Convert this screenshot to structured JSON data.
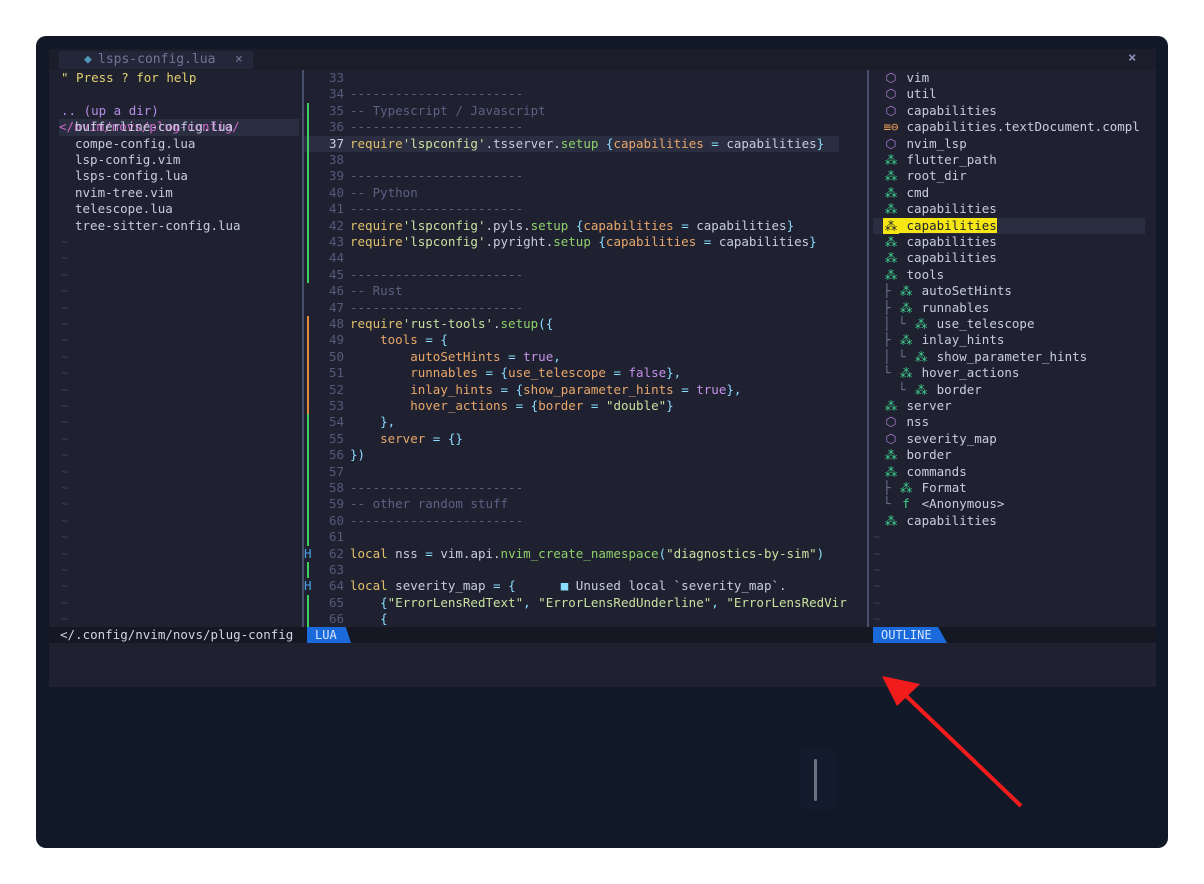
{
  "tab": {
    "icon": "lua-file-icon",
    "label": "lsps-config.lua",
    "close": "×"
  },
  "close_all": "×",
  "tree": {
    "help": "\" Press ? for help",
    "up": ".. (up a dir)",
    "cwd": "</nvim/novs/plug-config/",
    "files": [
      "bufferline-config.lua",
      "compe-config.lua",
      "lsp-config.vim",
      "lsps-config.lua",
      "nvim-tree.vim",
      "telescope.lua",
      "tree-sitter-config.lua"
    ],
    "tilde": "~"
  },
  "editor": {
    "lines": [
      {
        "n": "33",
        "segs": []
      },
      {
        "n": "34",
        "segs": [
          [
            "c-com",
            "-----------------------"
          ]
        ]
      },
      {
        "n": "35",
        "segs": [
          [
            "c-com",
            "-- Typescript / Javascript"
          ]
        ]
      },
      {
        "n": "36",
        "segs": [
          [
            "c-com",
            "-----------------------"
          ]
        ]
      },
      {
        "n": "37",
        "cur": true,
        "segs": [
          [
            "c-kw",
            "require"
          ],
          [
            "c-str",
            "'lspconfig'"
          ],
          [
            "c-var",
            ".tsserver."
          ],
          [
            "c-fn",
            "setup"
          ],
          [
            "c-var",
            " "
          ],
          [
            "c-punc",
            "{"
          ],
          [
            "c-prop",
            "capabilities"
          ],
          [
            "c-var",
            " "
          ],
          [
            "c-punc",
            "="
          ],
          [
            "c-var",
            " capabilities"
          ],
          [
            "c-punc",
            "}"
          ]
        ]
      },
      {
        "n": "38",
        "segs": []
      },
      {
        "n": "39",
        "segs": [
          [
            "c-com",
            "-----------------------"
          ]
        ]
      },
      {
        "n": "40",
        "segs": [
          [
            "c-com",
            "-- Python"
          ]
        ]
      },
      {
        "n": "41",
        "segs": [
          [
            "c-com",
            "-----------------------"
          ]
        ]
      },
      {
        "n": "42",
        "segs": [
          [
            "c-kw",
            "require"
          ],
          [
            "c-str",
            "'lspconfig'"
          ],
          [
            "c-var",
            ".pyls."
          ],
          [
            "c-fn",
            "setup"
          ],
          [
            "c-var",
            " "
          ],
          [
            "c-punc",
            "{"
          ],
          [
            "c-prop",
            "capabilities"
          ],
          [
            "c-var",
            " "
          ],
          [
            "c-punc",
            "="
          ],
          [
            "c-var",
            " capabilities"
          ],
          [
            "c-punc",
            "}"
          ]
        ]
      },
      {
        "n": "43",
        "segs": [
          [
            "c-kw",
            "require"
          ],
          [
            "c-str",
            "'lspconfig'"
          ],
          [
            "c-var",
            ".pyright."
          ],
          [
            "c-fn",
            "setup"
          ],
          [
            "c-var",
            " "
          ],
          [
            "c-punc",
            "{"
          ],
          [
            "c-prop",
            "capabilities"
          ],
          [
            "c-var",
            " "
          ],
          [
            "c-punc",
            "="
          ],
          [
            "c-var",
            " capabilities"
          ],
          [
            "c-punc",
            "}"
          ]
        ]
      },
      {
        "n": "44",
        "segs": []
      },
      {
        "n": "45",
        "segs": [
          [
            "c-com",
            "-----------------------"
          ]
        ]
      },
      {
        "n": "46",
        "segs": [
          [
            "c-com",
            "-- Rust"
          ]
        ]
      },
      {
        "n": "47",
        "segs": [
          [
            "c-com",
            "-----------------------"
          ]
        ]
      },
      {
        "n": "48",
        "segs": [
          [
            "c-kw",
            "require"
          ],
          [
            "c-str",
            "'rust-tools'"
          ],
          [
            "c-var",
            "."
          ],
          [
            "c-fn",
            "setup"
          ],
          [
            "c-punc",
            "({"
          ]
        ]
      },
      {
        "n": "49",
        "segs": [
          [
            "c-var",
            "    "
          ],
          [
            "c-prop",
            "tools"
          ],
          [
            "c-var",
            " "
          ],
          [
            "c-punc",
            "="
          ],
          [
            "c-var",
            " "
          ],
          [
            "c-punc",
            "{"
          ]
        ]
      },
      {
        "n": "50",
        "segs": [
          [
            "c-var",
            "        "
          ],
          [
            "c-prop",
            "autoSetHints"
          ],
          [
            "c-var",
            " "
          ],
          [
            "c-punc",
            "="
          ],
          [
            "c-var",
            " "
          ],
          [
            "c-bool",
            "true"
          ],
          [
            "c-punc",
            ","
          ]
        ]
      },
      {
        "n": "51",
        "segs": [
          [
            "c-var",
            "        "
          ],
          [
            "c-prop",
            "runnables"
          ],
          [
            "c-var",
            " "
          ],
          [
            "c-punc",
            "="
          ],
          [
            "c-var",
            " "
          ],
          [
            "c-punc",
            "{"
          ],
          [
            "c-prop",
            "use_telescope"
          ],
          [
            "c-var",
            " "
          ],
          [
            "c-punc",
            "="
          ],
          [
            "c-var",
            " "
          ],
          [
            "c-bool",
            "false"
          ],
          [
            "c-punc",
            "},"
          ]
        ]
      },
      {
        "n": "52",
        "segs": [
          [
            "c-var",
            "        "
          ],
          [
            "c-prop",
            "inlay_hints"
          ],
          [
            "c-var",
            " "
          ],
          [
            "c-punc",
            "="
          ],
          [
            "c-var",
            " "
          ],
          [
            "c-punc",
            "{"
          ],
          [
            "c-prop",
            "show_parameter_hints"
          ],
          [
            "c-var",
            " "
          ],
          [
            "c-punc",
            "="
          ],
          [
            "c-var",
            " "
          ],
          [
            "c-bool",
            "true"
          ],
          [
            "c-punc",
            "},"
          ]
        ]
      },
      {
        "n": "53",
        "segs": [
          [
            "c-var",
            "        "
          ],
          [
            "c-prop",
            "hover_actions"
          ],
          [
            "c-var",
            " "
          ],
          [
            "c-punc",
            "="
          ],
          [
            "c-var",
            " "
          ],
          [
            "c-punc",
            "{"
          ],
          [
            "c-prop",
            "border"
          ],
          [
            "c-var",
            " "
          ],
          [
            "c-punc",
            "="
          ],
          [
            "c-var",
            " "
          ],
          [
            "c-str",
            "\"double\""
          ],
          [
            "c-punc",
            "}"
          ]
        ]
      },
      {
        "n": "54",
        "segs": [
          [
            "c-var",
            "    "
          ],
          [
            "c-punc",
            "},"
          ]
        ]
      },
      {
        "n": "55",
        "segs": [
          [
            "c-var",
            "    "
          ],
          [
            "c-prop",
            "server"
          ],
          [
            "c-var",
            " "
          ],
          [
            "c-punc",
            "="
          ],
          [
            "c-var",
            " "
          ],
          [
            "c-punc",
            "{}"
          ]
        ]
      },
      {
        "n": "56",
        "segs": [
          [
            "c-punc",
            "})"
          ]
        ]
      },
      {
        "n": "57",
        "segs": []
      },
      {
        "n": "58",
        "segs": [
          [
            "c-com",
            "-----------------------"
          ]
        ]
      },
      {
        "n": "59",
        "segs": [
          [
            "c-com",
            "-- other random stuff"
          ]
        ]
      },
      {
        "n": "60",
        "segs": [
          [
            "c-com",
            "-----------------------"
          ]
        ]
      },
      {
        "n": "61",
        "segs": []
      },
      {
        "n": "62",
        "hint": "H",
        "segs": [
          [
            "c-kw",
            "local"
          ],
          [
            "c-var",
            " nss "
          ],
          [
            "c-punc",
            "="
          ],
          [
            "c-var",
            " vim.api."
          ],
          [
            "c-fn",
            "nvim_create_namespace"
          ],
          [
            "c-punc",
            "("
          ],
          [
            "c-str",
            "\"diagnostics-by-sim\""
          ],
          [
            "c-punc",
            ")"
          ]
        ]
      },
      {
        "n": "63",
        "segs": []
      },
      {
        "n": "64",
        "hint": "H",
        "segs": [
          [
            "c-kw",
            "local"
          ],
          [
            "c-var",
            " severity_map "
          ],
          [
            "c-punc",
            "="
          ],
          [
            "c-var",
            " "
          ],
          [
            "c-punc",
            "{"
          ],
          [
            "c-var",
            "      "
          ],
          [
            "c-punc",
            "■"
          ],
          [
            "c-var",
            " Unused local `severity_map`."
          ]
        ]
      },
      {
        "n": "65",
        "segs": [
          [
            "c-var",
            "    "
          ],
          [
            "c-punc",
            "{"
          ],
          [
            "c-str",
            "\"ErrorLensRedText\""
          ],
          [
            "c-punc",
            ","
          ],
          [
            "c-var",
            " "
          ],
          [
            "c-str",
            "\"ErrorLensRedUnderline\""
          ],
          [
            "c-punc",
            ","
          ],
          [
            "c-var",
            " "
          ],
          [
            "c-str",
            "\"ErrorLensRedVir"
          ]
        ]
      },
      {
        "n": "66",
        "segs": [
          [
            "c-var",
            "    "
          ],
          [
            "c-punc",
            "{"
          ]
        ]
      }
    ]
  },
  "outline": {
    "items": [
      {
        "icon": "⬡",
        "cls": "o-mod",
        "guide": "",
        "label": "vim"
      },
      {
        "icon": "⬡",
        "cls": "o-mod",
        "guide": "",
        "label": "util"
      },
      {
        "icon": "⬡",
        "cls": "o-mod",
        "guide": "",
        "label": "capabilities"
      },
      {
        "icon": "≡⊖",
        "cls": "o-orange",
        "guide": "",
        "label": "capabilities.textDocument.compl"
      },
      {
        "icon": "⬡",
        "cls": "o-mod",
        "guide": "",
        "label": "nvim_lsp"
      },
      {
        "icon": "⁂",
        "cls": "o-var",
        "guide": "",
        "label": "flutter_path"
      },
      {
        "icon": "⁂",
        "cls": "o-var",
        "guide": "",
        "label": "root_dir"
      },
      {
        "icon": "⁂",
        "cls": "o-var",
        "guide": "",
        "label": "cmd"
      },
      {
        "icon": "⁂",
        "cls": "o-var",
        "guide": "",
        "label": "capabilities"
      },
      {
        "icon": "⁂",
        "cls": "o-var",
        "guide": "",
        "label": "capabilities",
        "sel": true
      },
      {
        "icon": "⁂",
        "cls": "o-var",
        "guide": "",
        "label": "capabilities"
      },
      {
        "icon": "⁂",
        "cls": "o-var",
        "guide": "",
        "label": "capabilities"
      },
      {
        "icon": "⁂",
        "cls": "o-var",
        "guide": "",
        "label": "tools"
      },
      {
        "icon": "⁂",
        "cls": "o-var",
        "guide": "├ ",
        "label": "autoSetHints"
      },
      {
        "icon": "⁂",
        "cls": "o-var",
        "guide": "├ ",
        "label": "runnables"
      },
      {
        "icon": "⁂",
        "cls": "o-var",
        "guide": "│ └ ",
        "label": "use_telescope"
      },
      {
        "icon": "⁂",
        "cls": "o-var",
        "guide": "├ ",
        "label": "inlay_hints"
      },
      {
        "icon": "⁂",
        "cls": "o-var",
        "guide": "│ └ ",
        "label": "show_parameter_hints"
      },
      {
        "icon": "⁂",
        "cls": "o-var",
        "guide": "└ ",
        "label": "hover_actions"
      },
      {
        "icon": "⁂",
        "cls": "o-var",
        "guide": "  └ ",
        "label": "border"
      },
      {
        "icon": "⁂",
        "cls": "o-var",
        "guide": "",
        "label": "server"
      },
      {
        "icon": "⬡",
        "cls": "o-mod",
        "guide": "",
        "label": "nss"
      },
      {
        "icon": "⬡",
        "cls": "o-mod",
        "guide": "",
        "label": "severity_map"
      },
      {
        "icon": "⁂",
        "cls": "o-var",
        "guide": "",
        "label": "border"
      },
      {
        "icon": "⁂",
        "cls": "o-var",
        "guide": "",
        "label": "commands"
      },
      {
        "icon": "⁂",
        "cls": "o-var",
        "guide": "├ ",
        "label": "Format"
      },
      {
        "icon": "f",
        "cls": "o-var",
        "guide": "└ ",
        "label": "<Anonymous>"
      },
      {
        "icon": "⁂",
        "cls": "o-var",
        "guide": "",
        "label": "capabilities"
      }
    ]
  },
  "status": {
    "path": "</.config/nvim/novs/plug-config",
    "filetype": "LUA",
    "outline": "OUTLINE"
  },
  "colors": {
    "accent": "#1a6adb",
    "selection": "#f5e614",
    "gutter_add": "#3fcf5e",
    "gutter_change": "#e08a3c"
  }
}
